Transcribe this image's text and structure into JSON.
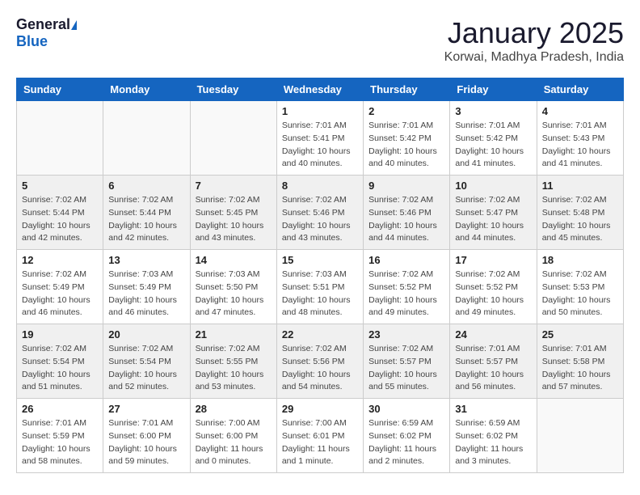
{
  "header": {
    "logo_general": "General",
    "logo_blue": "Blue",
    "month_title": "January 2025",
    "location": "Korwai, Madhya Pradesh, India"
  },
  "weekdays": [
    "Sunday",
    "Monday",
    "Tuesday",
    "Wednesday",
    "Thursday",
    "Friday",
    "Saturday"
  ],
  "weeks": [
    [
      {
        "day": "",
        "info": ""
      },
      {
        "day": "",
        "info": ""
      },
      {
        "day": "",
        "info": ""
      },
      {
        "day": "1",
        "info": "Sunrise: 7:01 AM\nSunset: 5:41 PM\nDaylight: 10 hours\nand 40 minutes."
      },
      {
        "day": "2",
        "info": "Sunrise: 7:01 AM\nSunset: 5:42 PM\nDaylight: 10 hours\nand 40 minutes."
      },
      {
        "day": "3",
        "info": "Sunrise: 7:01 AM\nSunset: 5:42 PM\nDaylight: 10 hours\nand 41 minutes."
      },
      {
        "day": "4",
        "info": "Sunrise: 7:01 AM\nSunset: 5:43 PM\nDaylight: 10 hours\nand 41 minutes."
      }
    ],
    [
      {
        "day": "5",
        "info": "Sunrise: 7:02 AM\nSunset: 5:44 PM\nDaylight: 10 hours\nand 42 minutes."
      },
      {
        "day": "6",
        "info": "Sunrise: 7:02 AM\nSunset: 5:44 PM\nDaylight: 10 hours\nand 42 minutes."
      },
      {
        "day": "7",
        "info": "Sunrise: 7:02 AM\nSunset: 5:45 PM\nDaylight: 10 hours\nand 43 minutes."
      },
      {
        "day": "8",
        "info": "Sunrise: 7:02 AM\nSunset: 5:46 PM\nDaylight: 10 hours\nand 43 minutes."
      },
      {
        "day": "9",
        "info": "Sunrise: 7:02 AM\nSunset: 5:46 PM\nDaylight: 10 hours\nand 44 minutes."
      },
      {
        "day": "10",
        "info": "Sunrise: 7:02 AM\nSunset: 5:47 PM\nDaylight: 10 hours\nand 44 minutes."
      },
      {
        "day": "11",
        "info": "Sunrise: 7:02 AM\nSunset: 5:48 PM\nDaylight: 10 hours\nand 45 minutes."
      }
    ],
    [
      {
        "day": "12",
        "info": "Sunrise: 7:02 AM\nSunset: 5:49 PM\nDaylight: 10 hours\nand 46 minutes."
      },
      {
        "day": "13",
        "info": "Sunrise: 7:03 AM\nSunset: 5:49 PM\nDaylight: 10 hours\nand 46 minutes."
      },
      {
        "day": "14",
        "info": "Sunrise: 7:03 AM\nSunset: 5:50 PM\nDaylight: 10 hours\nand 47 minutes."
      },
      {
        "day": "15",
        "info": "Sunrise: 7:03 AM\nSunset: 5:51 PM\nDaylight: 10 hours\nand 48 minutes."
      },
      {
        "day": "16",
        "info": "Sunrise: 7:02 AM\nSunset: 5:52 PM\nDaylight: 10 hours\nand 49 minutes."
      },
      {
        "day": "17",
        "info": "Sunrise: 7:02 AM\nSunset: 5:52 PM\nDaylight: 10 hours\nand 49 minutes."
      },
      {
        "day": "18",
        "info": "Sunrise: 7:02 AM\nSunset: 5:53 PM\nDaylight: 10 hours\nand 50 minutes."
      }
    ],
    [
      {
        "day": "19",
        "info": "Sunrise: 7:02 AM\nSunset: 5:54 PM\nDaylight: 10 hours\nand 51 minutes."
      },
      {
        "day": "20",
        "info": "Sunrise: 7:02 AM\nSunset: 5:54 PM\nDaylight: 10 hours\nand 52 minutes."
      },
      {
        "day": "21",
        "info": "Sunrise: 7:02 AM\nSunset: 5:55 PM\nDaylight: 10 hours\nand 53 minutes."
      },
      {
        "day": "22",
        "info": "Sunrise: 7:02 AM\nSunset: 5:56 PM\nDaylight: 10 hours\nand 54 minutes."
      },
      {
        "day": "23",
        "info": "Sunrise: 7:02 AM\nSunset: 5:57 PM\nDaylight: 10 hours\nand 55 minutes."
      },
      {
        "day": "24",
        "info": "Sunrise: 7:01 AM\nSunset: 5:57 PM\nDaylight: 10 hours\nand 56 minutes."
      },
      {
        "day": "25",
        "info": "Sunrise: 7:01 AM\nSunset: 5:58 PM\nDaylight: 10 hours\nand 57 minutes."
      }
    ],
    [
      {
        "day": "26",
        "info": "Sunrise: 7:01 AM\nSunset: 5:59 PM\nDaylight: 10 hours\nand 58 minutes."
      },
      {
        "day": "27",
        "info": "Sunrise: 7:01 AM\nSunset: 6:00 PM\nDaylight: 10 hours\nand 59 minutes."
      },
      {
        "day": "28",
        "info": "Sunrise: 7:00 AM\nSunset: 6:00 PM\nDaylight: 11 hours\nand 0 minutes."
      },
      {
        "day": "29",
        "info": "Sunrise: 7:00 AM\nSunset: 6:01 PM\nDaylight: 11 hours\nand 1 minute."
      },
      {
        "day": "30",
        "info": "Sunrise: 6:59 AM\nSunset: 6:02 PM\nDaylight: 11 hours\nand 2 minutes."
      },
      {
        "day": "31",
        "info": "Sunrise: 6:59 AM\nSunset: 6:02 PM\nDaylight: 11 hours\nand 3 minutes."
      },
      {
        "day": "",
        "info": ""
      }
    ]
  ]
}
